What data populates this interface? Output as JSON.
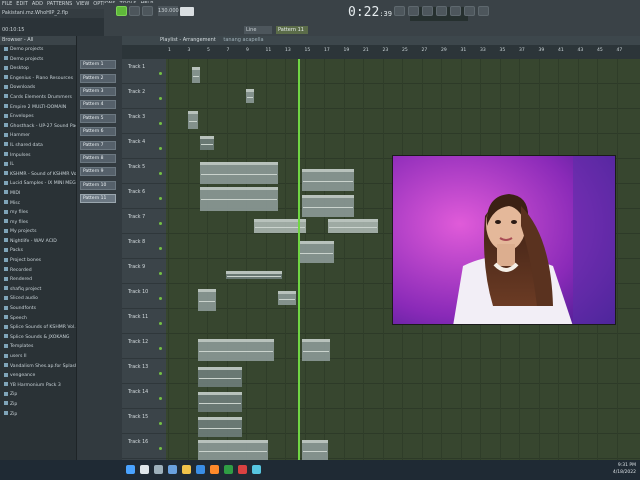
{
  "menu": [
    "FILE",
    "EDIT",
    "ADD",
    "PATTERNS",
    "VIEW",
    "OPTIONS",
    "TOOLS",
    "HELP"
  ],
  "project": {
    "file": "Pakistani.mz.WhoHIP_2.flp",
    "position": "00:10:15"
  },
  "transport": {
    "time": "0:22",
    "time_ms": ":39",
    "tempo": "130.000",
    "pattern": "Pattern 11",
    "mode_label": "Line"
  },
  "browser": {
    "header": "Browser - All",
    "items": [
      "Demo projects",
      "Demo projects",
      "Desktop",
      "Engenius - Piano Resources",
      "Downloads",
      "Cards Elements Drummers",
      "Empire 2 MULTI-DOMAIN",
      "Envelopes",
      "Ghosthack - UP-27 Sound Packs",
      "Hammer",
      "IL shared data",
      "Impulses",
      "IL",
      "KSHMR - Sound of KSHMR Vol.2",
      "Lucid Samples - IX MINI MEGA FX",
      "MIDI",
      "Misc",
      "my files",
      "my files",
      "My projects",
      "Nightlife - WAV ACID",
      "Packs",
      "Project bones",
      "Recorded",
      "Rendered",
      "shafiq project",
      "Sliced audio",
      "Soundfonts",
      "Speech",
      "Splice Sounds of KSHMR Vol.3",
      "Splice Sounds & JXOKANG",
      "Templates",
      "users Il",
      "Vandalism Shes.ap.for Splash",
      "vengeance",
      "YB Harmonium Pack 3",
      "Zip",
      "Zip",
      "Zip"
    ]
  },
  "patterns": [
    "Pattern 1",
    "Pattern 2",
    "Pattern 3",
    "Pattern 4",
    "Pattern 5",
    "Pattern 6",
    "Pattern 7",
    "Pattern 8",
    "Pattern 9",
    "Pattern 10",
    "Pattern 11"
  ],
  "playlist": {
    "title": "Playlist - Arrangement",
    "subtitle": "tanang acapella",
    "tracks": [
      "Track 1",
      "Track 2",
      "Track 3",
      "Track 4",
      "Track 5",
      "Track 6",
      "Track 7",
      "Track 8",
      "Track 9",
      "Track 10",
      "Track 11",
      "Track 12",
      "Track 13",
      "Track 14",
      "Track 15",
      "Track 16"
    ],
    "ruler": [
      "1",
      "3",
      "5",
      "7",
      "9",
      "11",
      "13",
      "15",
      "17",
      "19",
      "21",
      "23",
      "25",
      "27",
      "29",
      "31",
      "33",
      "35",
      "37",
      "39",
      "41",
      "43",
      "45",
      "47"
    ]
  },
  "taskbar": {
    "time": "9:31 PM",
    "date": "4/18/2022"
  },
  "colors": {
    "accent": "#70d644",
    "grid": "#37462f",
    "clip": "#8c9a97"
  }
}
